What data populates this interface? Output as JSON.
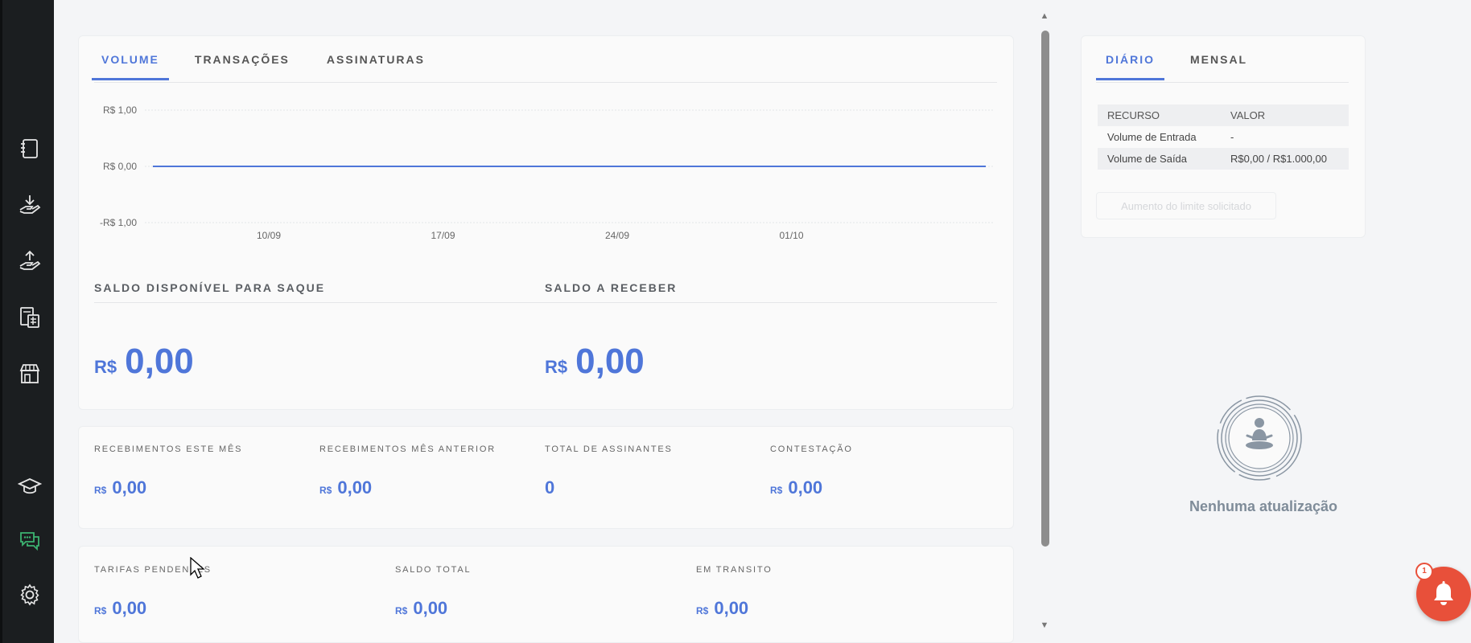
{
  "sidebar": {
    "icons": [
      "notebook-icon",
      "deposit-hand-icon",
      "withdraw-hand-icon",
      "calculator-icon",
      "store-icon",
      "graduation-cap-icon",
      "chat-support-icon",
      "settings-gear-icon"
    ],
    "accent_color": "#3cb371"
  },
  "main": {
    "tabs": [
      {
        "label": "VOLUME",
        "active": true
      },
      {
        "label": "TRANSAÇÕES",
        "active": false
      },
      {
        "label": "ASSINATURAS",
        "active": false
      }
    ],
    "balance_available_label": "SALDO DISPONÍVEL PARA SAQUE",
    "balance_available_currency": "R$",
    "balance_available_value": "0,00",
    "balance_receivable_label": "SALDO A RECEBER",
    "balance_receivable_currency": "R$",
    "balance_receivable_value": "0,00"
  },
  "chart_data": {
    "type": "line",
    "x": [
      "10/09",
      "17/09",
      "24/09",
      "01/10"
    ],
    "y_tick_labels": [
      "R$ 1,00",
      "R$ 0,00",
      "-R$ 1,00"
    ],
    "ylim": [
      -1,
      1
    ],
    "series": [
      {
        "values": [
          0,
          0,
          0,
          0
        ],
        "color": "#4f76d9"
      }
    ],
    "grid": true
  },
  "stats_row1": [
    {
      "label": "RECEBIMENTOS ESTE MÊS",
      "currency": "R$",
      "value": "0,00"
    },
    {
      "label": "RECEBIMENTOS MÊS ANTERIOR",
      "currency": "R$",
      "value": "0,00"
    },
    {
      "label": "TOTAL DE ASSINANTES",
      "currency": "",
      "value": "0"
    },
    {
      "label": "CONTESTAÇÃO",
      "currency": "R$",
      "value": "0,00"
    }
  ],
  "stats_row2": [
    {
      "label": "TARIFAS PENDENTES",
      "currency": "R$",
      "value": "0,00"
    },
    {
      "label": "SALDO TOTAL",
      "currency": "R$",
      "value": "0,00"
    },
    {
      "label": "EM TRANSITO",
      "currency": "R$",
      "value": "0,00"
    }
  ],
  "limits": {
    "tabs": [
      {
        "label": "DIÁRIO",
        "active": true
      },
      {
        "label": "MENSAL",
        "active": false
      }
    ],
    "header": {
      "resource": "RECURSO",
      "value": "VALOR"
    },
    "rows": [
      {
        "resource": "Volume de Entrada",
        "value": "-"
      },
      {
        "resource": "Volume de Saída",
        "value": "R$0,00 / R$1.000,00"
      }
    ],
    "button_label": "Aumento do limite solicitado"
  },
  "updates": {
    "empty_message": "Nenhuma atualização"
  },
  "notifications": {
    "badge_count": "1",
    "color": "#e8503a"
  }
}
